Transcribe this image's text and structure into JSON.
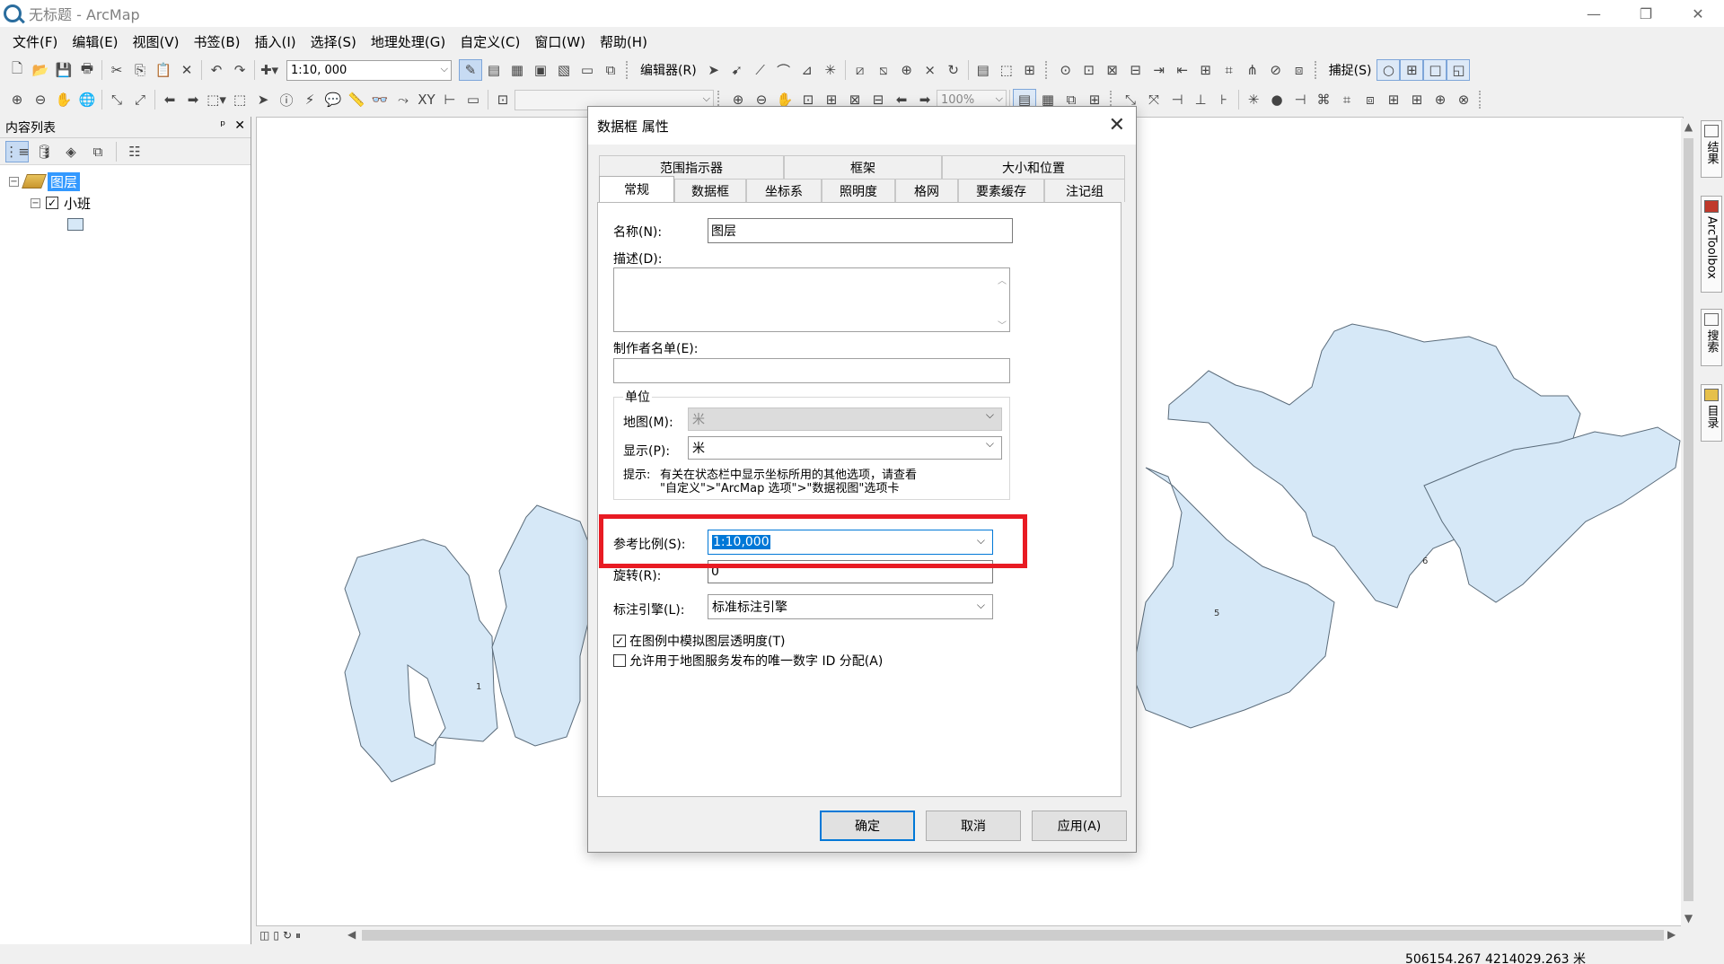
{
  "window": {
    "title": "无标题 - ArcMap",
    "minimize": "—",
    "restore": "❐",
    "close": "✕"
  },
  "menu": [
    "文件(F)",
    "编辑(E)",
    "视图(V)",
    "书签(B)",
    "插入(I)",
    "选择(S)",
    "地理处理(G)",
    "自定义(C)",
    "窗口(W)",
    "帮助(H)"
  ],
  "toolbar1": {
    "scale": "1:10, 000",
    "editor_label": "编辑器(R)",
    "snap_label": "捕捉(S)"
  },
  "toolbar2": {
    "zoom": "100%"
  },
  "toc": {
    "title": "内容列表",
    "pin": "ᵖ",
    "close": "✕",
    "dataframe": "图层",
    "layer": "小班",
    "expander_open": "−",
    "check": "✓"
  },
  "map": {
    "labels": [
      "1",
      "5",
      "6"
    ]
  },
  "right_dock": [
    "结果",
    "ArcToolbox",
    "搜索",
    "目录"
  ],
  "status": {
    "coords": "506154.267  4214029.263 米"
  },
  "dialog": {
    "title": "数据框 属性",
    "close": "✕",
    "tabs_row1": [
      "范围指示器",
      "框架",
      "大小和位置"
    ],
    "tabs_row2": [
      "常规",
      "数据框",
      "坐标系",
      "照明度",
      "格网",
      "要素缓存",
      "注记组"
    ],
    "active_tab": "常规",
    "name_label": "名称(N):",
    "name_value": "图层",
    "desc_label": "描述(D):",
    "desc_value": "",
    "author_label": "制作者名单(E):",
    "author_value": "",
    "units_group": "单位",
    "map_units_label": "地图(M):",
    "map_units_value": "米",
    "display_units_label": "显示(P):",
    "display_units_value": "米",
    "hint_prefix": "提示:",
    "hint_line1": "有关在状态栏中显示坐标所用的其他选项，请查看",
    "hint_line2": "\"自定义\">\"ArcMap 选项\">\"数据视图\"选项卡",
    "ref_scale_label": "参考比例(S):",
    "ref_scale_value": "1:10,000",
    "rotation_label": "旋转(R):",
    "rotation_value": "0",
    "label_engine_label": "标注引擎(L):",
    "label_engine_value": "标准标注引擎",
    "cb1_label": "在图例中模拟图层透明度(T)",
    "cb1_checked": "✓",
    "cb2_label": "允许用于地图服务发布的唯一数字 ID 分配(A)",
    "ok": "确定",
    "cancel": "取消",
    "apply": "应用(A)"
  }
}
